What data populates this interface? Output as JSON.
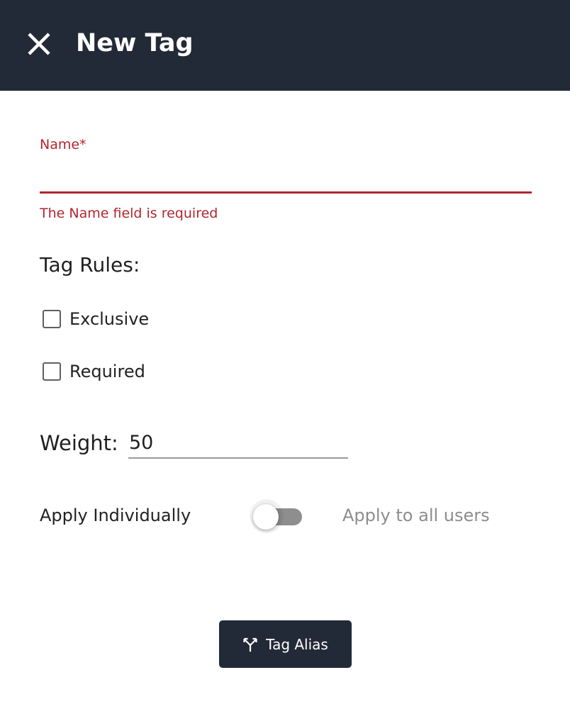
{
  "header": {
    "title": "New Tag",
    "close_icon": "close-icon",
    "background": "#232a37"
  },
  "form": {
    "name_label": "Name*",
    "name_value": "",
    "name_error": "The Name field is required",
    "error_color": "#b3262f",
    "rules_heading": "Tag Rules:",
    "checkboxes": [
      {
        "label": "Exclusive",
        "checked": false
      },
      {
        "label": "Required",
        "checked": false
      }
    ],
    "weight_label": "Weight:",
    "weight_value": "50",
    "toggle": {
      "left_label": "Apply Individually",
      "right_label": "Apply to all users",
      "on": false
    }
  },
  "alias_button": {
    "label": "Tag Alias",
    "icon": "fork-icon"
  }
}
